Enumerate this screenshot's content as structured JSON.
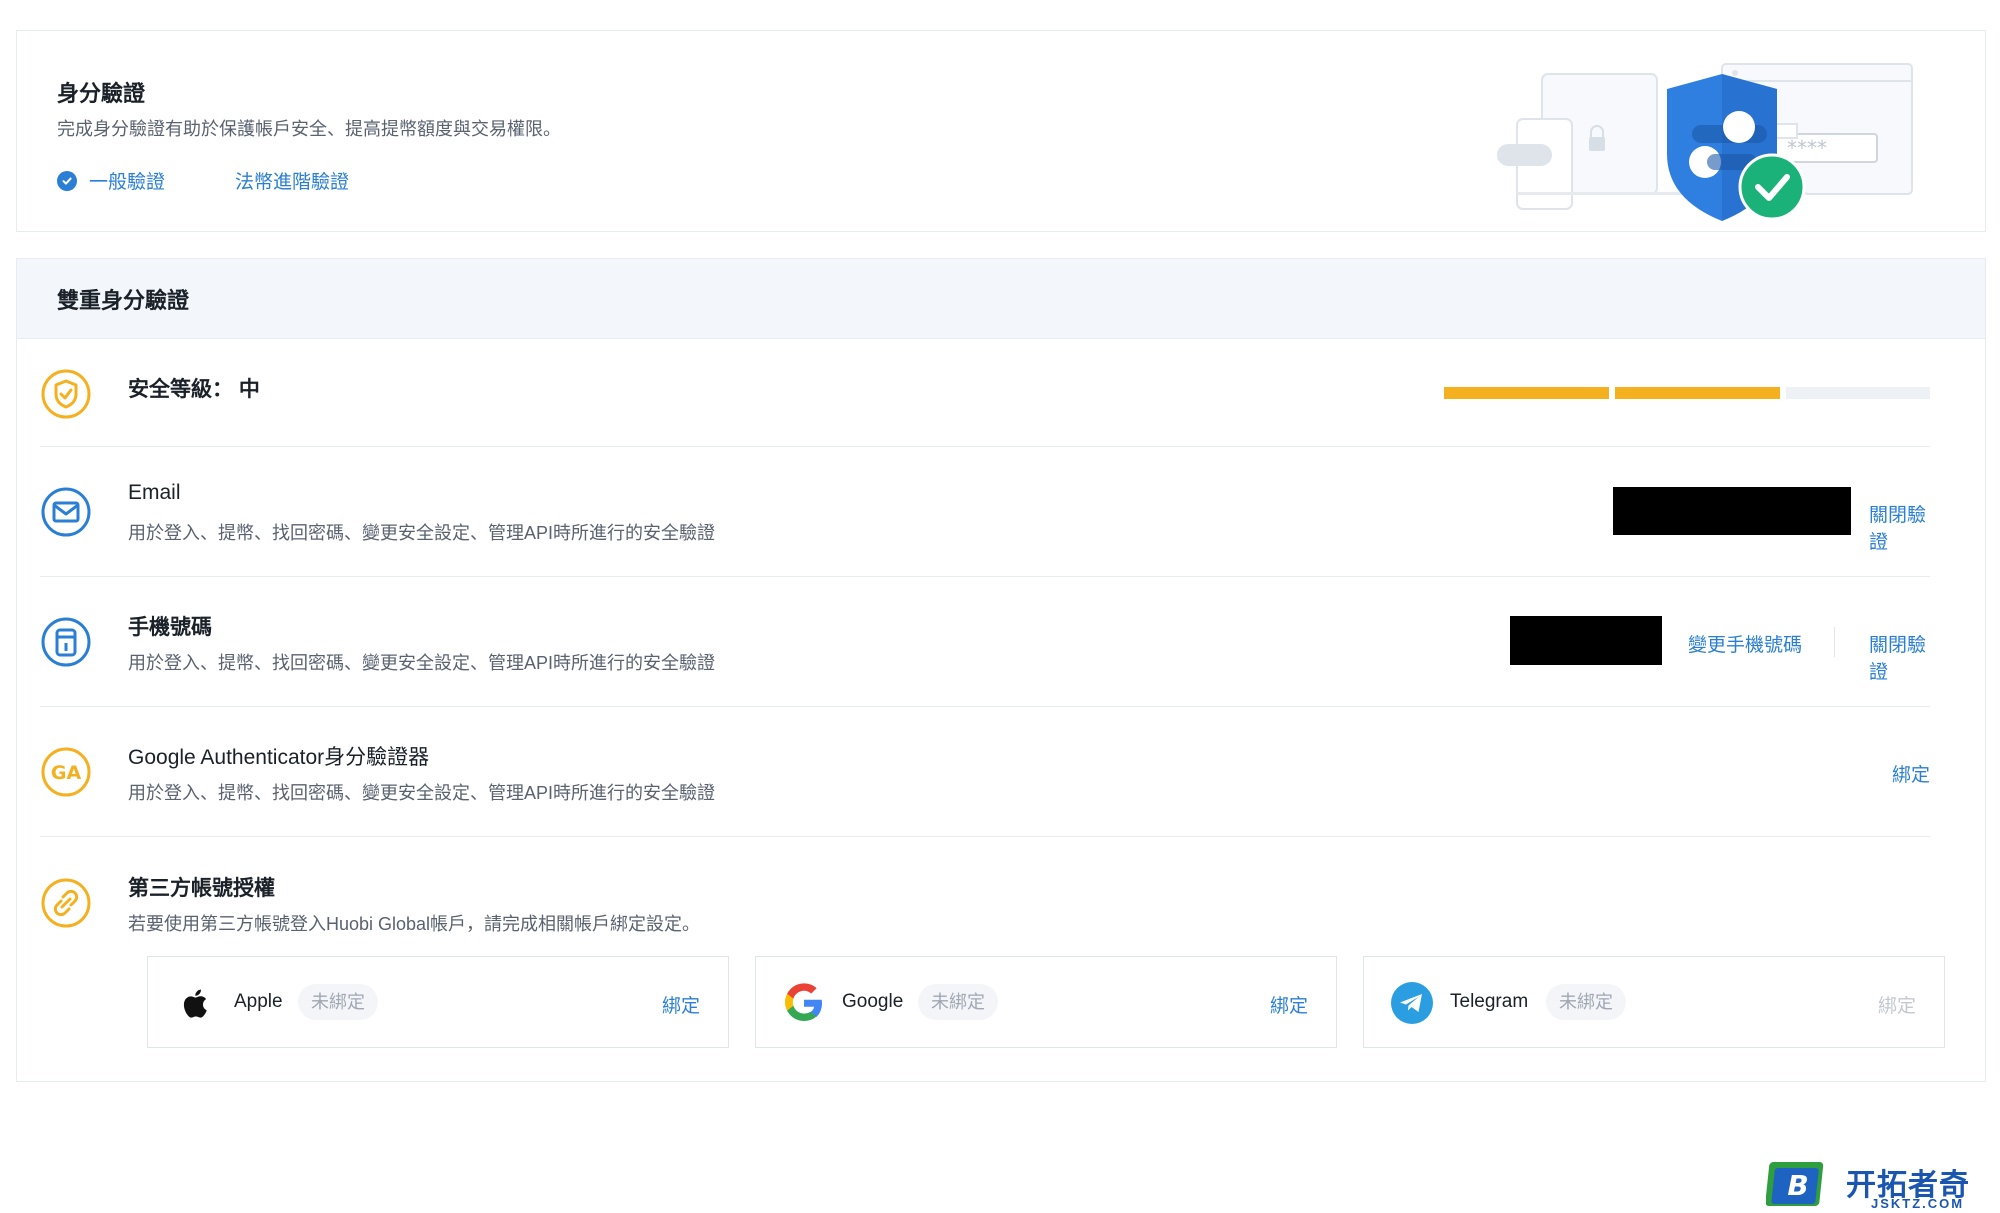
{
  "identity": {
    "title": "身分驗證",
    "description": "完成身分驗證有助於保護帳戶安全、提高提幣額度與交易權限。",
    "links": [
      {
        "label": "一般驗證"
      },
      {
        "label": "法幣進階驗證"
      }
    ],
    "illustration_password": "****"
  },
  "tfa": {
    "title": "雙重身分驗證",
    "security_level": {
      "label": "安全等級： 中",
      "filled_segments": 2,
      "total_segments": 3
    },
    "rows": [
      {
        "title": "Email",
        "description": "用於登入、提幣、找回密碼、變更安全設定、管理API時所進行的安全驗證",
        "actions": [
          "關閉驗證"
        ]
      },
      {
        "title": "手機號碼",
        "description": "用於登入、提幣、找回密碼、變更安全設定、管理API時所進行的安全驗證",
        "actions": [
          "變更手機號碼",
          "關閉驗證"
        ]
      },
      {
        "title": "Google Authenticator身分驗證器",
        "description": "用於登入、提幣、找回密碼、變更安全設定、管理API時所進行的安全驗證",
        "actions": [
          "綁定"
        ],
        "icon_text": "GA"
      }
    ],
    "third_party": {
      "title": "第三方帳號授權",
      "description": "若要使用第三方帳號登入Huobi Global帳戶，請完成相關帳戶綁定設定。",
      "providers": [
        {
          "name": "Apple",
          "status": "未綁定",
          "action": "綁定",
          "enabled": true
        },
        {
          "name": "Google",
          "status": "未綁定",
          "action": "綁定",
          "enabled": true
        },
        {
          "name": "Telegram",
          "status": "未綁定",
          "action": "綁定",
          "enabled": false
        }
      ]
    }
  },
  "watermark": {
    "text": "开拓者奇点",
    "sub": "JSKTZ.COM",
    "logo_letter": "B"
  },
  "colors": {
    "accent": "#2a7fd4",
    "warning": "#f5b020",
    "shield": "#2a7fd4",
    "success": "#1bb27a"
  }
}
